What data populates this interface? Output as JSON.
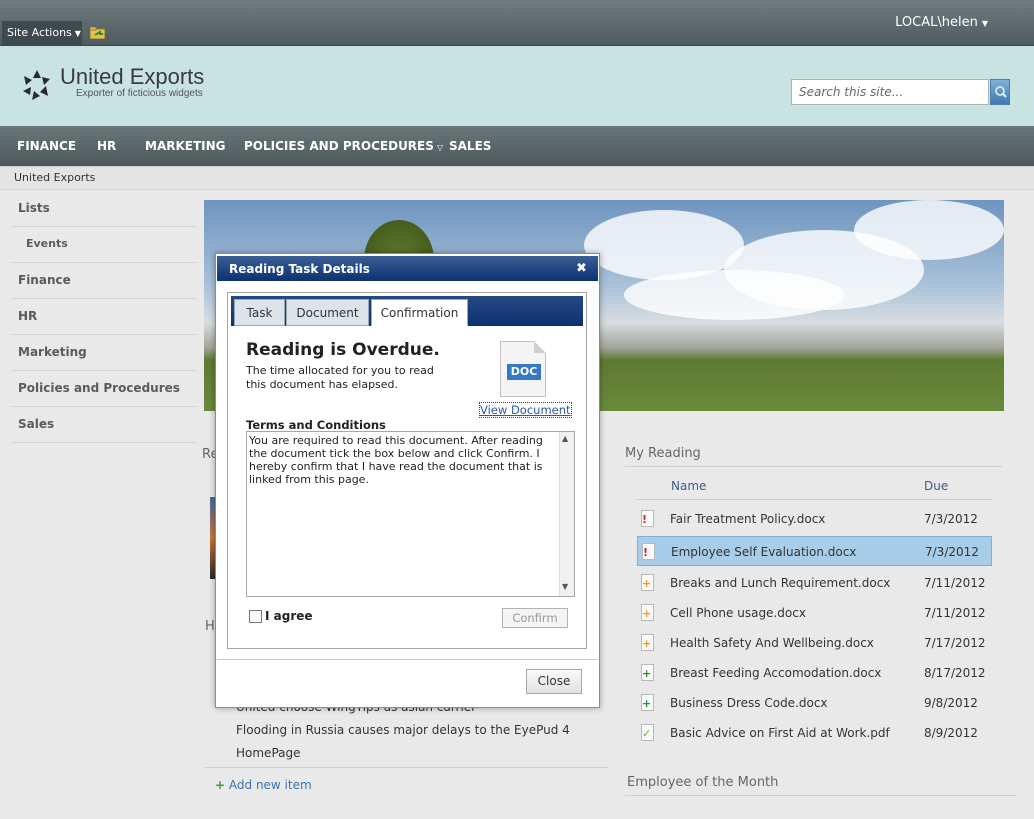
{
  "ribbon": {
    "site_actions": "Site Actions",
    "user": "LOCAL\\helen"
  },
  "header": {
    "site_title": "United Exports",
    "site_subtitle": "Exporter of ficticious widgets",
    "search_placeholder": "Search this site..."
  },
  "topnav": [
    "FINANCE",
    "HR",
    "MARKETING",
    "POLICIES AND PROCEDURES",
    "SALES"
  ],
  "breadcrumb": "United Exports",
  "quick_launch": [
    "Lists",
    "Events",
    "Finance",
    "HR",
    "Marketing",
    "Policies and Procedures",
    "Sales"
  ],
  "news": {
    "header_fragment": "Re",
    "header_fragment2": "H",
    "items": [
      "United choose WingTips as asian carrier",
      "Flooding in Russia causes major delays to the EyePud 4",
      "HomePage"
    ],
    "add_new_item": "Add new item"
  },
  "my_reading": {
    "title": "My Reading",
    "col_name": "Name",
    "col_due": "Due",
    "rows": [
      {
        "name": "Fair Treatment Policy.docx",
        "due": "7/3/2012",
        "status": "overdue"
      },
      {
        "name": "Employee Self Evaluation.docx",
        "due": "7/3/2012",
        "status": "overdue"
      },
      {
        "name": "Breaks and Lunch Requirement.docx",
        "due": "7/11/2012",
        "status": "due-soon"
      },
      {
        "name": "Cell Phone usage.docx",
        "due": "7/11/2012",
        "status": "due-soon"
      },
      {
        "name": "Health Safety And Wellbeing.docx",
        "due": "7/17/2012",
        "status": "due-soon"
      },
      {
        "name": "Breast Feeding Accomodation.docx",
        "due": "8/17/2012",
        "status": "new"
      },
      {
        "name": "Business Dress Code.docx",
        "due": "9/8/2012",
        "status": "new"
      },
      {
        "name": "Basic Advice on First Aid at Work.pdf",
        "due": "8/9/2012",
        "status": "done"
      }
    ],
    "selected_index": 1
  },
  "employee_of_month": "Employee of the Month",
  "dialog": {
    "title": "Reading Task Details",
    "tabs": [
      "Task",
      "Document",
      "Confirmation"
    ],
    "active_tab": "Confirmation",
    "overdue_title": "Reading is Overdue.",
    "overdue_text": "The time allocated for you to read this document has elapsed.",
    "doc_badge": "DOC",
    "view_document": "View Document",
    "terms_title": "Terms and Conditions",
    "terms_text": "You are required to read this document. After reading the document tick the box below and click Confirm. I hereby confirm that I have read the document that is linked from this page.",
    "agree_label": "I agree",
    "agree_checked": false,
    "confirm": "Confirm",
    "close": "Close"
  },
  "colors": {
    "nav_bg": "#56625f",
    "header_bg": "#c9e2e2",
    "dialog_title_bg": "#0d3172",
    "selected_row": "#a8cde8",
    "link": "#3b73af"
  }
}
